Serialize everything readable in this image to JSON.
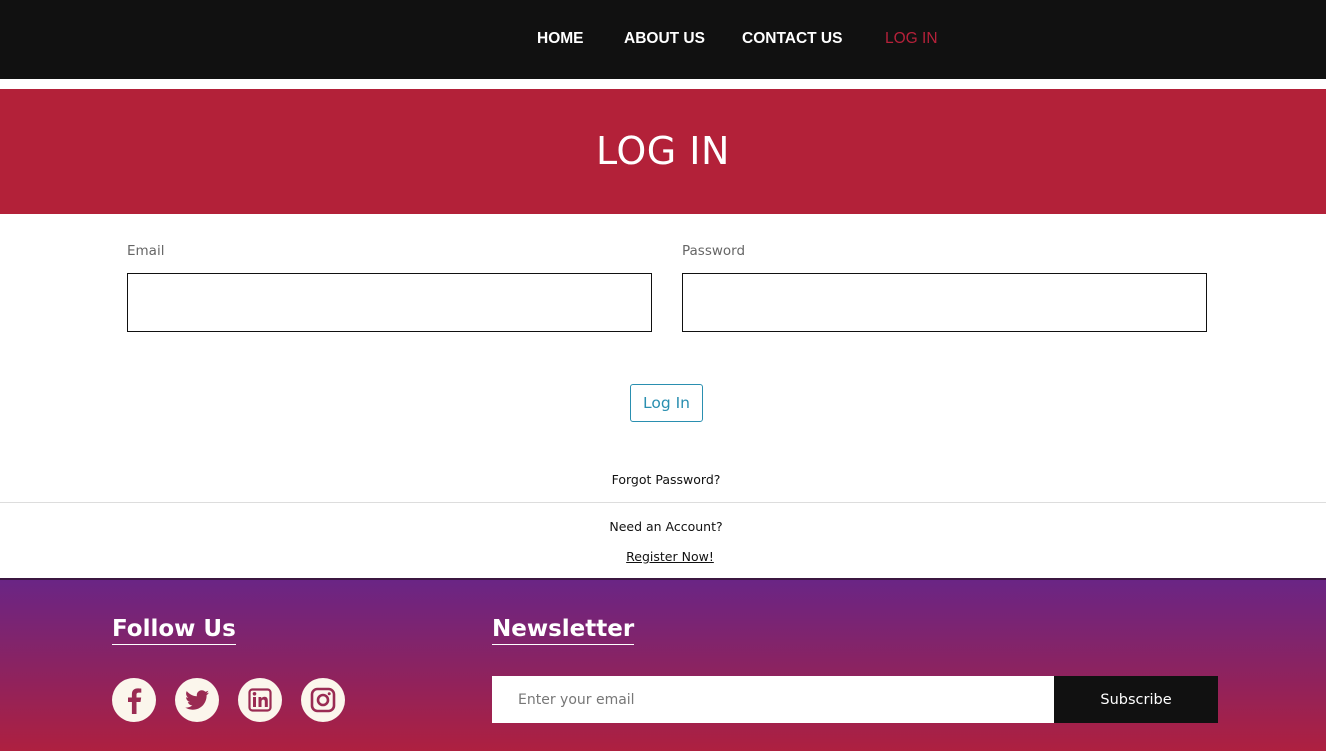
{
  "nav": {
    "items": [
      {
        "label": "HOME"
      },
      {
        "label": "ABOUT US"
      },
      {
        "label": "CONTACT US"
      },
      {
        "label": "LOG IN"
      }
    ],
    "active_color": "#b5213a"
  },
  "hero": {
    "title": "LOG IN",
    "background": "#b32139"
  },
  "form": {
    "email_label": "Email",
    "email_value": "",
    "password_label": "Password",
    "password_value": "",
    "submit_label": "Log In",
    "forgot_label": "Forgot Password?",
    "need_account_label": "Need an Account?",
    "register_label": "Register Now!"
  },
  "footer": {
    "follow_heading": "Follow Us",
    "social_icons": [
      "facebook-icon",
      "twitter-icon",
      "linkedin-icon",
      "instagram-icon"
    ],
    "newsletter_heading": "Newsletter",
    "newsletter_placeholder": "Enter your email",
    "subscribe_label": "Subscribe",
    "gradient_colors": [
      "#6a2585",
      "#ae2040"
    ]
  }
}
